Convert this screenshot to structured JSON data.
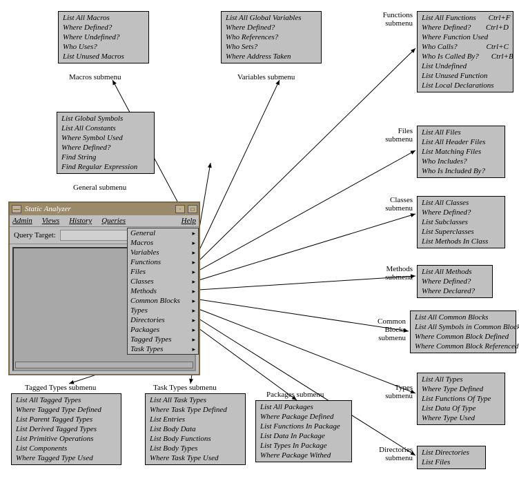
{
  "window": {
    "title": "Static Analyzer",
    "menubar": [
      "Admin",
      "Views",
      "History",
      "Queries",
      "Help"
    ],
    "query_label": "Query Target:"
  },
  "dropdown": {
    "items": [
      "General",
      "Macros",
      "Variables",
      "Functions",
      "Files",
      "Classes",
      "Methods",
      "Common Blocks",
      "Types",
      "Directories",
      "Packages",
      "Tagged Types",
      "Task Types"
    ]
  },
  "submenus": {
    "macros": {
      "label": "Macros submenu",
      "items": [
        "List All Macros",
        "Where Defined?",
        "Where Undefined?",
        "Who Uses?",
        "List Unused Macros"
      ]
    },
    "variables": {
      "label": "Variables submenu",
      "items": [
        "List All Global Variables",
        "Where Defined?",
        "Who References?",
        "Who Sets?",
        "Where Address Taken"
      ]
    },
    "functions": {
      "label": "Functions submenu",
      "items": [
        {
          "t": "List All Functions",
          "s": "Ctrl+F"
        },
        {
          "t": "Where Defined?",
          "s": "Ctrl+D"
        },
        {
          "t": "Where Function Used",
          "s": ""
        },
        {
          "t": "Who Calls?",
          "s": "Ctrl+C"
        },
        {
          "t": "Who Is Called By?",
          "s": "Ctrl+B"
        },
        {
          "t": "List Undefined",
          "s": ""
        },
        {
          "t": "List Unused Function",
          "s": ""
        },
        {
          "t": "List Local Declarations",
          "s": ""
        }
      ]
    },
    "general": {
      "label": "General submenu",
      "items": [
        "List Global Symbols",
        "List All Constants",
        "Where Symbol Used",
        "Where Defined?",
        "Find String",
        "Find Regular Expression"
      ]
    },
    "files": {
      "label": "Files submenu",
      "items": [
        "List All Files",
        "List All Header Files",
        "List Matching Files",
        "Who Includes?",
        "Who Is Included By?"
      ]
    },
    "classes": {
      "label": "Classes submenu",
      "items": [
        "List All Classes",
        "Where Defined?",
        "List Subclasses",
        "List Superclasses",
        "List Methods In Class"
      ]
    },
    "methods": {
      "label": "Methods submenu",
      "items": [
        "List All Methods",
        "Where Defined?",
        "Where Declared?"
      ]
    },
    "commonblocks": {
      "label": "Common Blocks submenu",
      "items": [
        "List All Common Blocks",
        "List All Symbols in Common Block",
        "Where Common Block Defined",
        "Where Common Block Referenced"
      ]
    },
    "types": {
      "label": "Types submenu",
      "items": [
        "List All Types",
        "Where Type Defined",
        "List Functions Of Type",
        "List Data Of Type",
        "Where Type Used"
      ]
    },
    "directories": {
      "label": "Directories submenu",
      "items": [
        "List Directories",
        "List Files"
      ]
    },
    "taggedtypes": {
      "label": "Tagged Types submenu",
      "items": [
        "List All Tagged Types",
        "Where Tagged Type Defined",
        "List Parent Tagged Types",
        "List Derived Tagged Types",
        "List Primitive Operations",
        "List Components",
        "Where Tagged Type Used"
      ]
    },
    "tasktypes": {
      "label": "Task Types submenu",
      "items": [
        "List All Task Types",
        "Where Task Type Defined",
        "List Entries",
        "List Body Data",
        "List Body Functions",
        "List Body Types",
        "Where Task Type Used"
      ]
    },
    "packages": {
      "label": "Packages submenu",
      "items": [
        "List All Packages",
        "Where Package Defined",
        "List Functions In Package",
        "List Data In Package",
        "List Types In Package",
        "Where Package Withed"
      ]
    }
  }
}
